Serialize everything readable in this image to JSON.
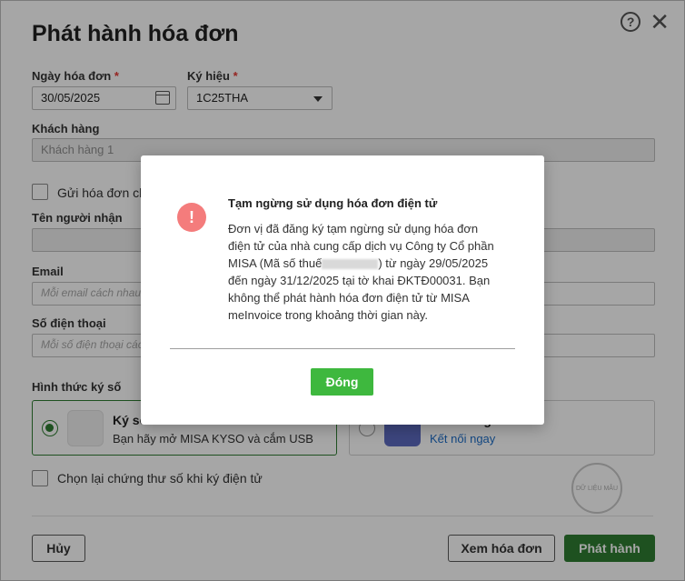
{
  "dialog": {
    "title": "Phát hành hóa đơn",
    "invoice_date": {
      "label": "Ngày hóa đơn",
      "required": "*",
      "value": "30/05/2025"
    },
    "symbol": {
      "label": "Ký hiệu",
      "required": "*",
      "value": "1C25THA"
    },
    "customer": {
      "label": "Khách hàng",
      "value": "Khách hàng 1"
    },
    "send_invoice_checkbox": {
      "label": "Gửi hóa đơn ch"
    },
    "recipient_name": {
      "label": "Tên người nhận",
      "value": ""
    },
    "email": {
      "label": "Email",
      "placeholder": "Mỗi email cách nhau"
    },
    "phone": {
      "label": "Số điện thoại",
      "placeholder": "Mỗi số điện thoại các"
    },
    "signing_method": {
      "label": "Hình thức ký số",
      "options": [
        {
          "title": "Ký số",
          "subtitle": "Bạn hãy mở MISA KYSO và cắm USB",
          "selected": true,
          "icon": "usb-token-icon"
        },
        {
          "title": "MISA eSign",
          "subtitle": "Kết nối ngay",
          "selected": false,
          "icon": "esign-icon"
        }
      ]
    },
    "reselect_cert_checkbox": {
      "label": "Chọn lại chứng thư số khi ký điện tử"
    },
    "watermark": "DỮ LIỆU MẪU",
    "buttons": {
      "cancel": "Hủy",
      "view_invoice": "Xem hóa đơn",
      "issue": "Phát hành"
    }
  },
  "modal": {
    "title": "Tạm ngừng sử dụng hóa đơn điện tử",
    "body_line1": "Đơn vị đã đăng ký tạm ngừng sử dụng hóa đơn",
    "body_line2": "điện tử của nhà cung cấp dịch vụ Công ty Cổ phần",
    "body_line3_a": "MISA (Mã số thuế",
    "body_line3_b": ") từ ngày 29/05/2025",
    "body_line4": "đến ngày 31/12/2025 tại tờ khai ĐKTĐ00031. Bạn",
    "body_line5": "không thể phát hành hóa đơn điện tử từ MISA",
    "body_line6": "meInvoice trong khoảng thời gian này.",
    "close_button": "Đóng",
    "icon": "warning-exclamation-icon"
  },
  "colors": {
    "primary_green": "#2e7d32",
    "modal_button_green": "#3eb83e",
    "warning_red": "#f47c7c",
    "link_blue": "#1e6ec8"
  }
}
